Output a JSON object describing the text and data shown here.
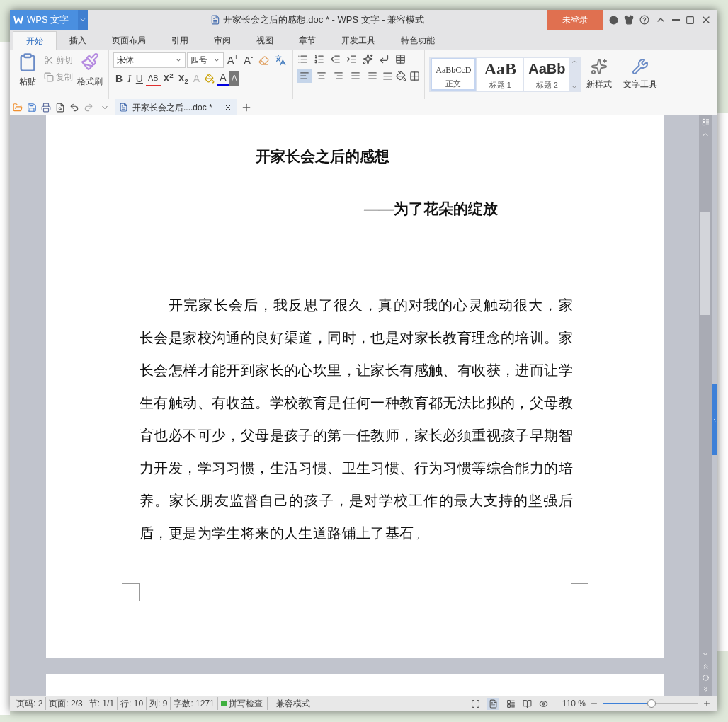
{
  "app_menu": {
    "label": "WPS 文字"
  },
  "window": {
    "title": "开家长会之后的感想.doc * - WPS 文字 - 兼容模式",
    "login": "未登录"
  },
  "tabs": [
    {
      "label": "开始",
      "selected": true
    },
    {
      "label": "插入",
      "selected": false
    },
    {
      "label": "页面布局",
      "selected": false
    },
    {
      "label": "引用",
      "selected": false
    },
    {
      "label": "审阅",
      "selected": false
    },
    {
      "label": "视图",
      "selected": false
    },
    {
      "label": "章节",
      "selected": false
    },
    {
      "label": "开发工具",
      "selected": false
    },
    {
      "label": "特色功能",
      "selected": false
    }
  ],
  "clipboard": {
    "paste": "粘贴",
    "cut": "剪切",
    "copy": "复制",
    "format_painter": "格式刷"
  },
  "font": {
    "name": "宋体",
    "size": "四号",
    "grow": "A$^{+}$",
    "shrink": "A$^{-}$",
    "bold": "B",
    "italic": "I",
    "underline": "U",
    "strike": "AB",
    "superscript": "X$^{2}$",
    "subscript": "X$_{2}$",
    "effect": "A",
    "font_color": "A",
    "shade": "A"
  },
  "align": [
    {
      "selected": true
    },
    {
      "selected": false
    },
    {
      "selected": false
    },
    {
      "selected": false
    },
    {
      "selected": false
    }
  ],
  "styles": [
    {
      "sample": "AaBbCcD",
      "label": "正文",
      "selected": true,
      "kind": "body"
    },
    {
      "sample": "AaB",
      "label": "标题 1",
      "selected": false,
      "kind": "h1"
    },
    {
      "sample": "AaBb",
      "label": "标题 2",
      "selected": false,
      "kind": "h2"
    }
  ],
  "new_style": "新样式",
  "text_tools": "文字工具",
  "doc_tab": {
    "label": "开家长会之后....doc *"
  },
  "document": {
    "title": "开家长会之后的感想",
    "subtitle": "——为了花朵的绽放",
    "paragraph": "开完家长会后，我反思了很久，真的对我的心灵触动很大，家长会是家校沟通的良好渠道，同时，也是对家长教育理念的培训。家长会怎样才能开到家长的心坎里，让家长有感触、有收获，进而让学生有触动、有收益。学校教育是任何一种教育都无法比拟的，父母教育也必不可少，父母是孩子的第一任教师，家长必须重视孩子早期智力开发，学习习惯，生活习惯、卫生习惯、行为习惯等综合能力的培养。家长朋友监督自己的孩子，是对学校工作的最大支持的坚强后盾，更是为学生将来的人生道路铺上了基石。"
  },
  "status_bar": {
    "items": [
      "页码: 2",
      "页面: 2/3",
      "节: 1/1",
      "行: 10",
      "列: 9",
      "字数: 1271"
    ],
    "spell_check": {
      "label": "拼写检查",
      "on": true
    },
    "mode": "兼容模式",
    "zoom": {
      "label": "110 %",
      "level": 0.51
    }
  }
}
